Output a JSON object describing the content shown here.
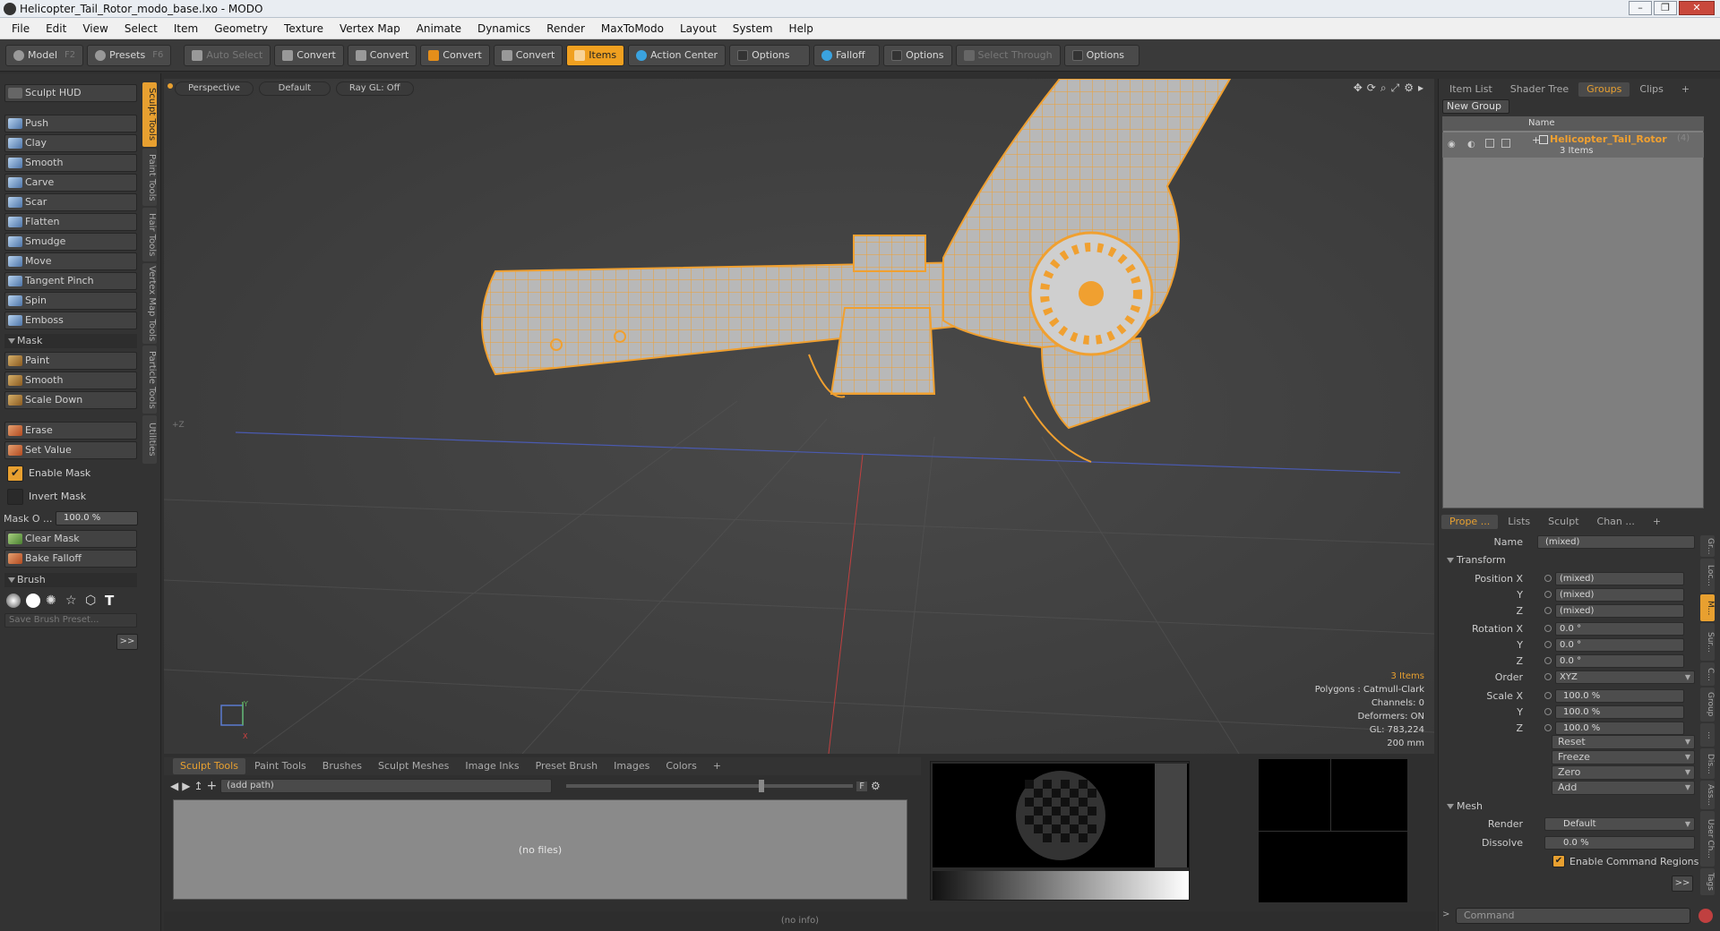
{
  "window": {
    "title": "Helicopter_Tail_Rotor_modo_base.lxo - MODO",
    "min": "–",
    "max": "❐",
    "close": "✕"
  },
  "menu": [
    "File",
    "Edit",
    "View",
    "Select",
    "Item",
    "Geometry",
    "Texture",
    "Vertex Map",
    "Animate",
    "Dynamics",
    "Render",
    "MaxToModo",
    "Layout",
    "System",
    "Help"
  ],
  "toolbar": {
    "model": "Model",
    "model_key": "F2",
    "presets": "Presets",
    "presets_key": "F6",
    "auto_select": "Auto Select",
    "convert1": "Convert",
    "convert2": "Convert",
    "convert3": "Convert",
    "convert4": "Convert",
    "items": "Items",
    "action_center": "Action Center",
    "options1": "Options",
    "falloff": "Falloff",
    "options2": "Options",
    "select_through": "Select Through",
    "options3": "Options"
  },
  "left": {
    "hud": "Sculpt HUD",
    "tools": [
      "Push",
      "Clay",
      "Smooth",
      "Carve",
      "Scar",
      "Flatten",
      "Smudge",
      "Move",
      "Tangent Pinch",
      "Spin",
      "Emboss"
    ],
    "mask_section": "Mask",
    "mask_tools": [
      "Paint",
      "Smooth",
      "Scale Down"
    ],
    "erase": "Erase",
    "set_value": "Set Value",
    "enable_mask": "Enable Mask",
    "invert_mask": "Invert Mask",
    "mask_opacity_label": "Mask O ...",
    "mask_opacity_value": "100.0 %",
    "clear_mask": "Clear Mask",
    "bake_falloff": "Bake Falloff",
    "brush_section": "Brush",
    "save_brush": "Save Brush Preset...",
    "more": ">>",
    "vtabs": [
      "Sculpt Tools",
      "Paint Tools",
      "Hair Tools",
      "Vertex Map Tools",
      "Particle Tools",
      "Utilities"
    ]
  },
  "viewport": {
    "perspective": "Perspective",
    "default": "Default",
    "raygl": "Ray GL: Off",
    "info": {
      "items": "3 Items",
      "polygons": "Polygons : Catmull-Clark",
      "channels": "Channels: 0",
      "deformers": "Deformers: ON",
      "gl": "GL: 783,224",
      "scale": "200 mm"
    },
    "axis_y": "Y",
    "axis_x": "X",
    "axis_z": "+Z"
  },
  "bottom": {
    "tabs": [
      "Sculpt Tools",
      "Paint Tools",
      "Brushes",
      "Sculpt Meshes",
      "Image Inks",
      "Preset Brush",
      "Images",
      "Colors",
      "+"
    ],
    "path": "(add path)",
    "no_files": "(no files)",
    "no_info": "(no info)",
    "f_btn": "F"
  },
  "right": {
    "top_tabs": [
      "Item List",
      "Shader Tree",
      "Groups",
      "Clips",
      "+"
    ],
    "new_group": "New Group",
    "name_col": "Name",
    "group_name": "Helicopter_Tail_Rotor",
    "group_badge": "(4)",
    "group_count": "3 Items",
    "prop_tabs": [
      "Prope ...",
      "Lists",
      "Sculpt",
      "Chan ...",
      "+"
    ],
    "name_label": "Name",
    "name_value": "(mixed)",
    "transform": "Transform",
    "pos_label": "Position X",
    "y": "Y",
    "z": "Z",
    "mixed": "(mixed)",
    "rot_label": "Rotation X",
    "zero_deg": "0.0 °",
    "order_label": "Order",
    "order_value": "XYZ",
    "scale_label": "Scale X",
    "scale_value": "100.0 %",
    "actions": [
      "Reset",
      "Freeze",
      "Zero",
      "Add"
    ],
    "mesh": "Mesh",
    "render_label": "Render",
    "render_value": "Default",
    "dissolve_label": "Dissolve",
    "dissolve_value": "0.0 %",
    "enable_cmd": "Enable Command Regions",
    "more": ">>",
    "command": "Command",
    "rvtabs": [
      "Gr...",
      "Loc...",
      "M...",
      "Sur...",
      "C...",
      "Group",
      "...",
      "Dis...",
      "Ass...",
      "User Ch...",
      "Tags"
    ]
  },
  "colors": {
    "accent": "#e8a030",
    "wire": "#f0a030",
    "mesh": "#b0b0b0"
  }
}
